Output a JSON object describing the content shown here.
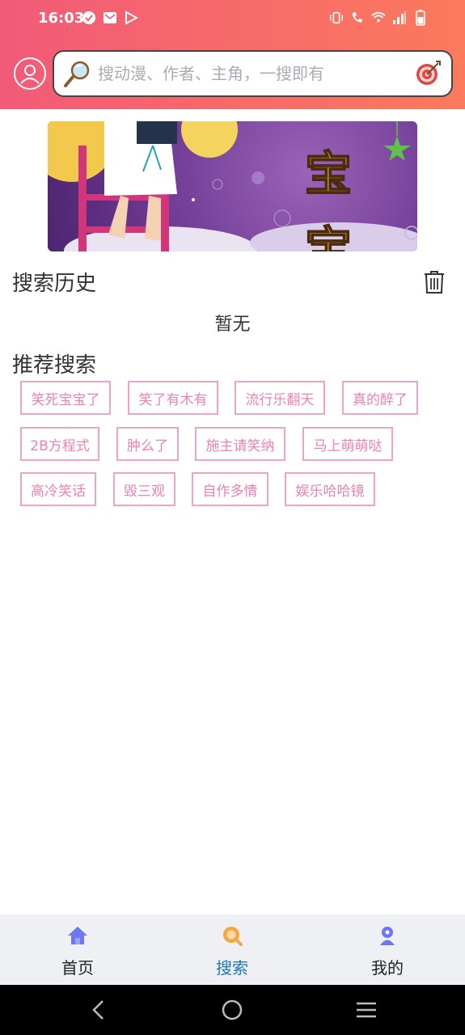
{
  "status_bar": {
    "time": "16:03"
  },
  "search": {
    "placeholder": "搜动漫、作者、主角，一搜即有"
  },
  "history": {
    "title": "搜索历史",
    "empty_text": "暂无"
  },
  "recommend": {
    "title": "推荐搜索",
    "tags": [
      "笑死宝宝了",
      "笑了有木有",
      "流行乐翻天",
      "真的醉了",
      "2B方程式",
      "肿么了",
      "施主请笑纳",
      "马上萌萌哒",
      "高冷笑话",
      "毁三观",
      "自作多情",
      "娱乐哈哈镜"
    ]
  },
  "banner": {
    "text": "宝"
  },
  "bottom_nav": {
    "items": [
      {
        "label": "首页",
        "icon": "home-icon"
      },
      {
        "label": "搜索",
        "icon": "search-icon",
        "active": true
      },
      {
        "label": "我的",
        "icon": "profile-icon"
      }
    ]
  },
  "colors": {
    "header_start": "#f25a78",
    "header_end": "#fb7a5c",
    "tag_border": "#f0a3c9",
    "tag_text": "#ec82b6",
    "nav_active": "#1f78b4"
  }
}
